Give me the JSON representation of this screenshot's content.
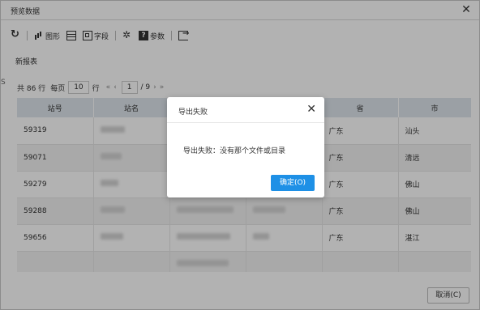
{
  "window": {
    "title": "预览数据"
  },
  "toolbar": {
    "chart_label": "图形",
    "field_label": "字段",
    "param_label": "参数"
  },
  "report": {
    "name": "新报表"
  },
  "side_mark": "S",
  "pager": {
    "total": "共 86 行",
    "per_page_label": "每页",
    "per_page_value": "10",
    "rows_unit": "行",
    "first": "«",
    "prev": "‹",
    "page_value": "1",
    "page_total": "/ 9",
    "next": "›",
    "last": "»"
  },
  "table": {
    "headers": [
      "站号",
      "站名",
      "",
      "",
      "省",
      "市"
    ],
    "rows": [
      {
        "id": "59319",
        "province": "广东",
        "city": "汕头"
      },
      {
        "id": "59071",
        "province": "广东",
        "city": "清远"
      },
      {
        "id": "59279",
        "province": "广东",
        "city": "佛山"
      },
      {
        "id": "59288",
        "province": "广东",
        "city": "佛山"
      },
      {
        "id": "59656",
        "province": "广东",
        "city": "湛江"
      },
      {
        "id": "",
        "province": "",
        "city": ""
      }
    ]
  },
  "footer": {
    "cancel_label": "取消(C)"
  },
  "dialog": {
    "title": "导出失败",
    "message": "导出失败：没有那个文件或目录",
    "ok_label": "确定(O)"
  }
}
